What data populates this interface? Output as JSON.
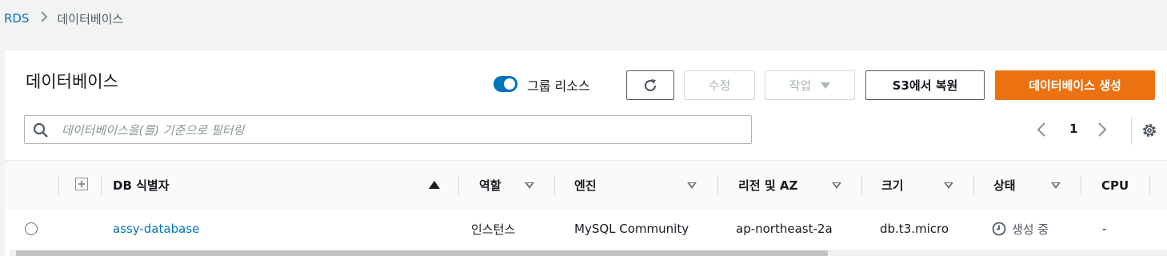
{
  "breadcrumb": {
    "root": "RDS",
    "current": "데이터베이스"
  },
  "panel": {
    "title": "데이터베이스",
    "group_toggle": {
      "label": "그룹 리소스",
      "on": true
    },
    "buttons": {
      "edit": "수정",
      "actions": "작업",
      "restore_s3": "S3에서 복원",
      "create": "데이터베이스 생성"
    },
    "search": {
      "placeholder": "데이터베이스을(를) 기준으로 필터링",
      "value": ""
    },
    "pagination": {
      "page": "1"
    }
  },
  "table": {
    "columns": [
      "DB 식별자",
      "역할",
      "엔진",
      "리전 및 AZ",
      "크기",
      "상태",
      "CPU"
    ],
    "rows": [
      {
        "identifier": "assy-database",
        "role": "인스턴스",
        "engine": "MySQL Community",
        "region_az": "ap-northeast-2a",
        "size": "db.t3.micro",
        "status": "생성 중",
        "cpu": "-"
      }
    ]
  },
  "colors": {
    "primary": "#ec7211",
    "link": "#0073bb",
    "text": "#16191f"
  },
  "icons": [
    "chevron-right-icon",
    "refresh-icon",
    "caret-down-icon",
    "search-icon",
    "chevron-left-icon",
    "gear-icon",
    "expand-all-icon",
    "sort-ascending-icon",
    "sort-icon",
    "clock-icon"
  ]
}
